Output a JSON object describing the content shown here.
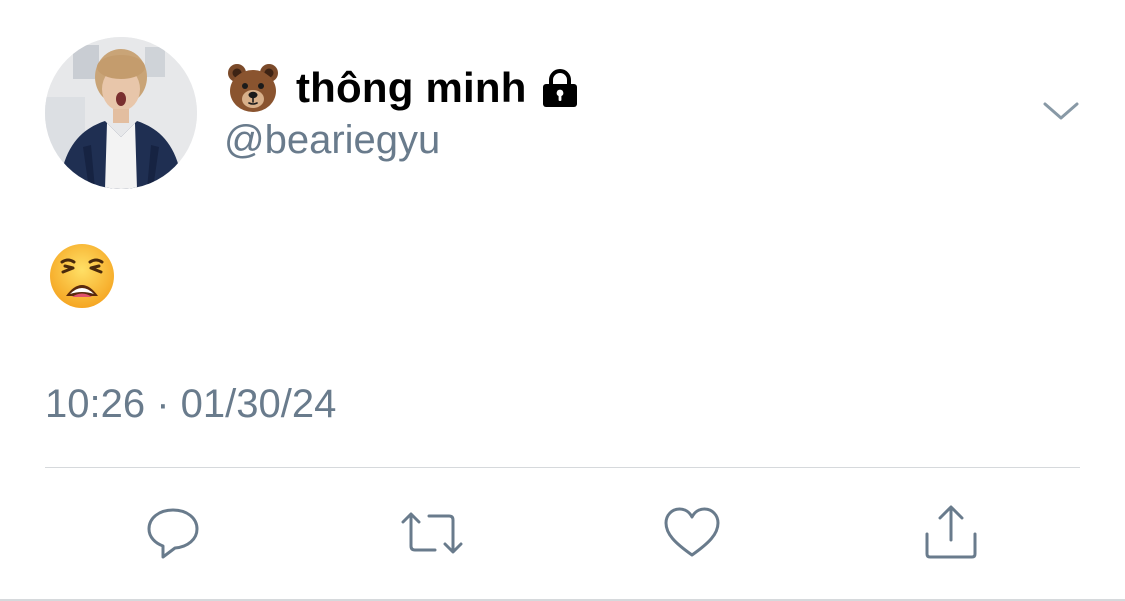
{
  "user": {
    "display_name": "thông minh",
    "handle": "@beariegyu",
    "name_emoji": "bear-face-emoji",
    "protected_icon": "lock-icon"
  },
  "tweet": {
    "body_emoji": "weary-face-emoji",
    "timestamp": "10:26 · 01/30/24"
  },
  "actions": [
    {
      "name": "reply",
      "icon": "speech-bubble-icon"
    },
    {
      "name": "retweet",
      "icon": "retweet-icon"
    },
    {
      "name": "like",
      "icon": "heart-icon"
    },
    {
      "name": "share",
      "icon": "share-icon"
    }
  ],
  "colors": {
    "text_primary": "#000000",
    "text_secondary": "#697b8c",
    "icon": "#697b8c",
    "divider": "#d6d9dc",
    "background": "#ffffff"
  }
}
